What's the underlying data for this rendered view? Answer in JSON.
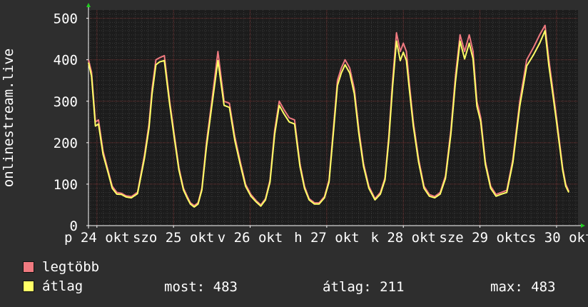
{
  "colors": {
    "background": "#2e2e2e",
    "plot_background": "#1c1c1c",
    "grid_minor": "#3a3a3a",
    "grid_major": "#6b2a2a",
    "axis": "#ffffff",
    "arrow": "#22cc22",
    "max_series": "#f07a80",
    "avg_series": "#ffff66"
  },
  "legend": [
    {
      "label": "legtöbb",
      "color": "#f07a80"
    },
    {
      "label": "átlag",
      "color": "#ffff66"
    }
  ],
  "stats": {
    "most_label": "most:",
    "most_value": "483",
    "atlag_label": "átlag:",
    "atlag_value": "211",
    "max_label": "max:",
    "max_value": "483"
  },
  "chart_data": {
    "type": "line",
    "ylabel": "onlinestream.live",
    "ylim": [
      0,
      520
    ],
    "yticks": [
      0,
      100,
      200,
      300,
      400,
      500
    ],
    "xlim": [
      -0.11,
      6.28
    ],
    "xticks": [
      {
        "at": 0.0,
        "label": "p 24 okt"
      },
      {
        "at": 1.0,
        "label": "szo 25 okt"
      },
      {
        "at": 2.0,
        "label": "v 26 okt"
      },
      {
        "at": 3.0,
        "label": "h 27 okt"
      },
      {
        "at": 4.0,
        "label": "k 28 okt"
      },
      {
        "at": 5.0,
        "label": "sze 29 okt"
      },
      {
        "at": 6.0,
        "label": "cs 30 okt"
      }
    ],
    "grid": true,
    "series": [
      {
        "name": "legtöbb",
        "x": [
          -0.11,
          -0.07,
          -0.02,
          0.02,
          0.08,
          0.15,
          0.2,
          0.26,
          0.32,
          0.38,
          0.45,
          0.53,
          0.62,
          0.68,
          0.72,
          0.77,
          0.82,
          0.88,
          0.95,
          1.01,
          1.07,
          1.13,
          1.18,
          1.22,
          1.27,
          1.32,
          1.37,
          1.43,
          1.5,
          1.58,
          1.66,
          1.73,
          1.8,
          1.87,
          1.94,
          2.01,
          2.08,
          2.14,
          2.2,
          2.26,
          2.32,
          2.38,
          2.44,
          2.51,
          2.58,
          2.65,
          2.71,
          2.77,
          2.84,
          2.9,
          2.97,
          3.03,
          3.09,
          3.14,
          3.19,
          3.24,
          3.3,
          3.36,
          3.42,
          3.48,
          3.55,
          3.63,
          3.7,
          3.76,
          3.81,
          3.86,
          3.91,
          3.96,
          4.0,
          4.04,
          4.08,
          4.13,
          4.2,
          4.27,
          4.34,
          4.41,
          4.48,
          4.55,
          4.62,
          4.68,
          4.74,
          4.8,
          4.86,
          4.91,
          4.96,
          5.01,
          5.07,
          5.14,
          5.21,
          5.28,
          5.35,
          5.43,
          5.52,
          5.61,
          5.7,
          5.78,
          5.85,
          5.9,
          5.95,
          6.0,
          6.04,
          6.08,
          6.12,
          6.16
        ],
        "values": [
          400,
          370,
          250,
          255,
          180,
          130,
          95,
          80,
          78,
          72,
          70,
          80,
          170,
          245,
          330,
          400,
          405,
          410,
          300,
          220,
          140,
          90,
          70,
          55,
          48,
          55,
          90,
          200,
          300,
          420,
          300,
          295,
          215,
          155,
          100,
          75,
          60,
          50,
          65,
          110,
          230,
          300,
          280,
          260,
          255,
          150,
          95,
          65,
          55,
          55,
          70,
          110,
          240,
          350,
          380,
          400,
          380,
          330,
          230,
          150,
          95,
          65,
          80,
          115,
          215,
          350,
          465,
          420,
          440,
          420,
          340,
          250,
          160,
          95,
          75,
          70,
          80,
          120,
          230,
          360,
          460,
          420,
          460,
          420,
          300,
          260,
          155,
          95,
          75,
          80,
          85,
          160,
          300,
          400,
          430,
          460,
          483,
          400,
          330,
          260,
          200,
          140,
          100,
          83
        ]
      },
      {
        "name": "átlag",
        "x": [
          -0.11,
          -0.07,
          -0.02,
          0.02,
          0.08,
          0.15,
          0.2,
          0.26,
          0.32,
          0.38,
          0.45,
          0.53,
          0.62,
          0.68,
          0.72,
          0.77,
          0.82,
          0.88,
          0.95,
          1.01,
          1.07,
          1.13,
          1.18,
          1.22,
          1.27,
          1.32,
          1.37,
          1.43,
          1.5,
          1.58,
          1.66,
          1.73,
          1.8,
          1.87,
          1.94,
          2.01,
          2.08,
          2.14,
          2.2,
          2.26,
          2.32,
          2.38,
          2.44,
          2.51,
          2.58,
          2.65,
          2.71,
          2.77,
          2.84,
          2.9,
          2.97,
          3.03,
          3.09,
          3.14,
          3.19,
          3.24,
          3.3,
          3.36,
          3.42,
          3.48,
          3.55,
          3.63,
          3.7,
          3.76,
          3.81,
          3.86,
          3.91,
          3.96,
          4.0,
          4.04,
          4.08,
          4.13,
          4.2,
          4.27,
          4.34,
          4.41,
          4.48,
          4.55,
          4.62,
          4.68,
          4.74,
          4.8,
          4.86,
          4.91,
          4.96,
          5.01,
          5.07,
          5.14,
          5.21,
          5.28,
          5.35,
          5.43,
          5.52,
          5.61,
          5.7,
          5.78,
          5.85,
          5.9,
          5.95,
          6.0,
          6.04,
          6.08,
          6.12,
          6.16
        ],
        "values": [
          393,
          360,
          240,
          245,
          172,
          125,
          90,
          76,
          75,
          69,
          67,
          77,
          162,
          235,
          318,
          388,
          395,
          398,
          292,
          212,
          134,
          86,
          66,
          52,
          45,
          52,
          86,
          190,
          288,
          398,
          290,
          285,
          206,
          148,
          95,
          71,
          57,
          47,
          62,
          105,
          220,
          290,
          270,
          250,
          245,
          143,
          90,
          62,
          52,
          52,
          67,
          105,
          230,
          338,
          368,
          388,
          368,
          318,
          220,
          143,
          90,
          62,
          76,
          110,
          205,
          336,
          445,
          398,
          418,
          398,
          326,
          240,
          152,
          90,
          71,
          67,
          76,
          114,
          220,
          346,
          445,
          402,
          440,
          402,
          288,
          250,
          148,
          90,
          71,
          76,
          80,
          152,
          288,
          385,
          412,
          440,
          470,
          385,
          318,
          250,
          192,
          134,
          95,
          80
        ]
      }
    ]
  }
}
